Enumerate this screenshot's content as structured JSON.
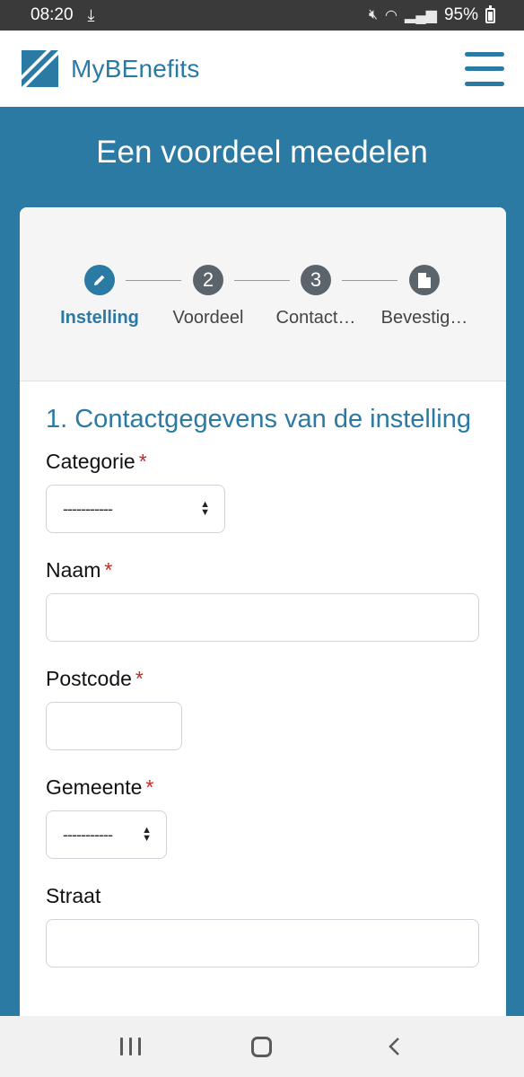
{
  "status_bar": {
    "time": "08:20",
    "battery": "95%"
  },
  "header": {
    "logo_text": "MyBEnefits"
  },
  "page": {
    "title": "Een voordeel meedelen"
  },
  "stepper": {
    "steps": [
      {
        "label": "Instelling",
        "marker": "pencil-icon",
        "active": true
      },
      {
        "label": "Voordeel",
        "marker": "2",
        "active": false
      },
      {
        "label": "Contact…",
        "marker": "3",
        "active": false
      },
      {
        "label": "Bevestig…",
        "marker": "document-icon",
        "active": false
      }
    ]
  },
  "form": {
    "section_title": "1. Contactgegevens van de instelling",
    "fields": {
      "categorie": {
        "label": "Categorie",
        "required_mark": "*",
        "value": "-----------"
      },
      "naam": {
        "label": "Naam",
        "required_mark": "*",
        "value": ""
      },
      "postcode": {
        "label": "Postcode",
        "required_mark": "*",
        "value": ""
      },
      "gemeente": {
        "label": "Gemeente",
        "required_mark": "*",
        "value": "-----------"
      },
      "straat": {
        "label": "Straat",
        "value": ""
      }
    }
  },
  "colors": {
    "brand": "#2b7aa3",
    "step_inactive": "#5b636b",
    "required": "#c62828"
  }
}
